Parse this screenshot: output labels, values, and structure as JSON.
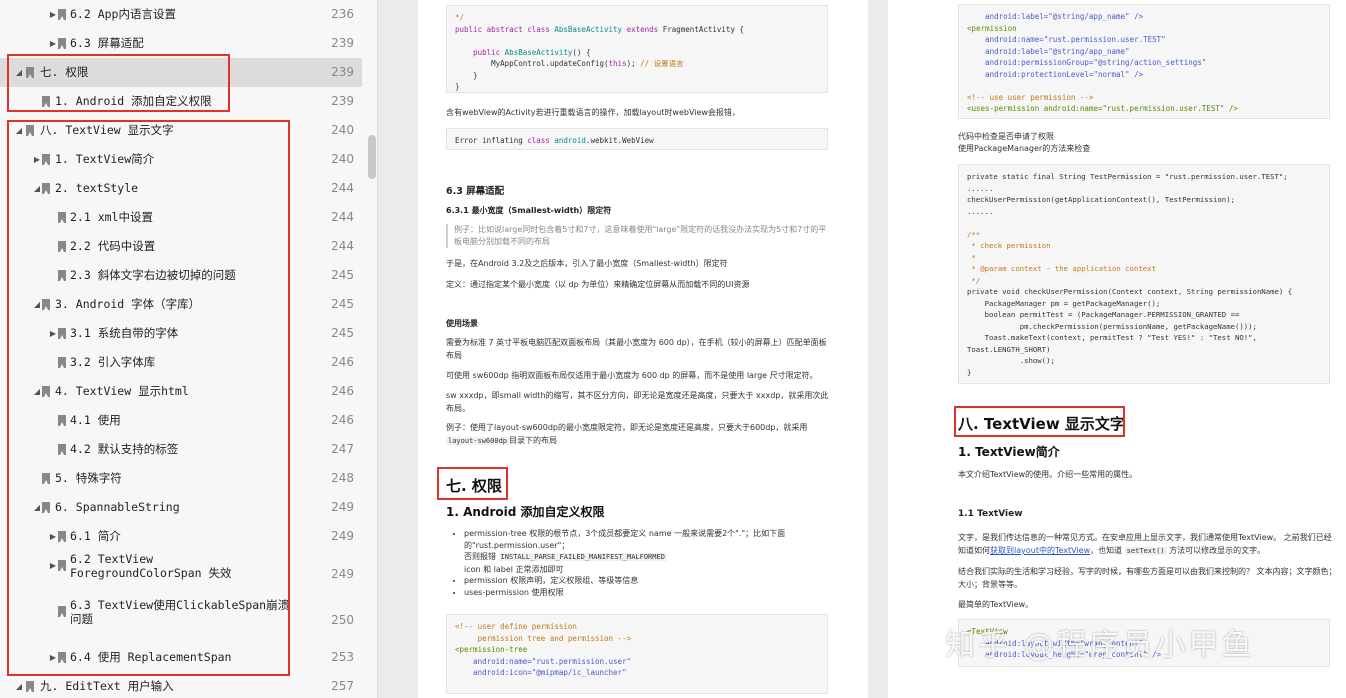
{
  "toc": {
    "items": [
      {
        "label": "6.2 App内语言设置",
        "page": "236",
        "level": 2,
        "arrow": "▶"
      },
      {
        "label": "6.3 屏幕适配",
        "page": "239",
        "level": 2,
        "arrow": "▶"
      },
      {
        "label": "七. 权限",
        "page": "239",
        "level": 0,
        "arrow": "◢",
        "selected": true
      },
      {
        "label": "1. Android 添加自定义权限",
        "page": "239",
        "level": 1,
        "arrow": ""
      },
      {
        "label": "八. TextView 显示文字",
        "page": "240",
        "level": 0,
        "arrow": "◢"
      },
      {
        "label": "1. TextView简介",
        "page": "240",
        "level": 1,
        "arrow": "▶"
      },
      {
        "label": "2. textStyle",
        "page": "244",
        "level": 1,
        "arrow": "◢"
      },
      {
        "label": "2.1 xml中设置",
        "page": "244",
        "level": 2,
        "arrow": ""
      },
      {
        "label": "2.2 代码中设置",
        "page": "244",
        "level": 2,
        "arrow": ""
      },
      {
        "label": "2.3 斜体文字右边被切掉的问题",
        "page": "245",
        "level": 2,
        "arrow": ""
      },
      {
        "label": "3. Android 字体（字库）",
        "page": "245",
        "level": 1,
        "arrow": "◢"
      },
      {
        "label": "3.1 系统自带的字体",
        "page": "245",
        "level": 2,
        "arrow": "▶"
      },
      {
        "label": "3.2 引入字体库",
        "page": "246",
        "level": 2,
        "arrow": ""
      },
      {
        "label": "4. TextView 显示html",
        "page": "246",
        "level": 1,
        "arrow": "◢"
      },
      {
        "label": "4.1 使用",
        "page": "246",
        "level": 2,
        "arrow": ""
      },
      {
        "label": "4.2 默认支持的标签",
        "page": "247",
        "level": 2,
        "arrow": ""
      },
      {
        "label": "5. 特殊字符",
        "page": "248",
        "level": 1,
        "arrow": ""
      },
      {
        "label": "6. SpannableString",
        "page": "249",
        "level": 1,
        "arrow": "◢"
      },
      {
        "label": "6.1 简介",
        "page": "249",
        "level": 2,
        "arrow": "▶"
      },
      {
        "label": "6.2 TextView ForegroundColorSpan 失效",
        "page": "249",
        "level": 2,
        "arrow": "▶",
        "two": true
      },
      {
        "label": "6.3 TextView使用ClickableSpan崩溃问题",
        "page": "250",
        "level": 2,
        "arrow": "",
        "two": true
      },
      {
        "label": "6.4 使用 ReplacementSpan",
        "page": "253",
        "level": 2,
        "arrow": "▶"
      },
      {
        "label": "九. EditText 用户输入",
        "page": "257",
        "level": 0,
        "arrow": "◢"
      }
    ]
  },
  "mid": {
    "code1": [
      "*/",
      "public abstract class AbsBaseActivity extends FragmentActivity {",
      "",
      "    public AbsBaseActivity() {",
      "        MyAppControl.updateConfig(this); // 设置语言",
      "    }",
      "}"
    ],
    "p_webview": "含有webView的Activity若进行重载语言的操作，加载layout时webView会报错，",
    "code2": "Error inflating class android.webkit.WebView",
    "h_63": "6.3 屏幕适配",
    "h_631": "6.3.1 最小宽度（Smallest-width）限定符",
    "quote": "例子：比如说large同时包含着5寸和7寸，这意味着使用\"large\"限定符的话我没办法实现为5寸和7寸的平板电脑分别加载不同的布局",
    "p1": "于是，在Android 3.2及之后版本，引入了最小宽度（Smallest-width）限定符",
    "p2": "定义：通过指定某个最小宽度（以 dp 为单位）来精确定位屏幕从而加载不同的UI资源",
    "h_use": "使用场景",
    "p3": "需要为标准 7 英寸平板电脑匹配双面板布局（其最小宽度为 600 dp），在手机（较小的屏幕上）匹配单面板布局",
    "p4": "可使用 sw600dp 指明双面板布局仅适用于最小宽度为 600 dp 的屏幕，而不是使用 large 尺寸限定符。",
    "p5": "sw xxxdp，即small width的缩写，其不区分方向，即无论是宽度还是高度，只要大于 xxxdp，就采用次此布局。",
    "p6a": "例子：使用了layout-sw600dp的最小宽度限定符，即无论是宽度还是高度，只要大于600dp，就采用",
    "p6code": "layout-sw600dp",
    "p6b": "目录下的布局",
    "h_7": "七. 权限",
    "h_71": "1. Android 添加自定义权限",
    "b1": "permission-tree 权限的根节点，3个成员都要定义 name 一般来说需要2个\".\"；比如下面的\"rust.permission.user\"；",
    "b1b": "否则报错",
    "b1code": "INSTALL_PARSE_FAILED_MANIFEST_MALFORMED",
    "b1c": "icon 和 label 正常添加即可",
    "b2": "permission 权限声明，定义权限组、等级等信息",
    "b3": "uses-permission 使用权限",
    "code3": [
      "<!-- user define permission",
      "     permission tree and permission -->",
      "<permission-tree",
      "    android:name=\"rust.permission.user\"",
      "    android:icon=\"@mipmap/ic_launcher\""
    ]
  },
  "right": {
    "code1": [
      "    android:label=\"@string/app_name\" />",
      "<permission",
      "    android:name=\"rust.permission.user.TEST\"",
      "    android:label=\"@string/app_name\"",
      "    android:permissionGroup=\"@string/action_settings\"",
      "    android:protectionLevel=\"normal\" />",
      "",
      "<!-- use user permission -->",
      "<uses-permission android:name=\"rust.permission.user.TEST\" />"
    ],
    "p_check1": "代码中检查是否申请了权限",
    "p_check2": "使用PackageManager的方法来检查",
    "code2": [
      "private static final String TestPermission = \"rust.permission.user.TEST\";",
      "......",
      "checkUserPermission(getApplicationContext(), TestPermission);",
      "......",
      "",
      "/**",
      " * check permission",
      " *",
      " * @param context - the application context",
      " */",
      "private void checkUserPermission(Context context, String permissionName) {",
      "    PackageManager pm = getPackageManager();",
      "    boolean permitTest = (PackageManager.PERMISSION_GRANTED ==",
      "            pm.checkPermission(permissionName, getPackageName()));",
      "    Toast.makeText(context, permitTest ? \"Test YES!\" : \"Test NO!\",",
      "Toast.LENGTH_SHORT)",
      "            .show();",
      "}"
    ],
    "h_8": "八. TextView 显示文字",
    "h_81": "1. TextView简介",
    "p_intro": "本文介绍TextView的使用。介绍一些常用的属性。",
    "h_811": "1.1 TextView",
    "p_tv1a": "文字，是我们传达信息的一种常见方式。在安卓应用上显示文字，我们通常使用TextView。 之前我们已经知道如何",
    "p_tv1link": "获取到layout中的TextView",
    "p_tv1b": "，也知道",
    "p_tv1code": "setText()",
    "p_tv1c": "方法可以修改显示的文字。",
    "p_tv2": "结合我们实际的生活和学习经验，写字的时候，有哪些方面是可以由我们来控制的？ 文本内容；文字颜色；大小；背景等等。",
    "p_tv3": "最简单的TextView。",
    "code3": [
      "<TextView",
      "    android:layout_width=\"wrap_content\"",
      "    android:layout_height=\"wrap_content\" />"
    ]
  },
  "watermark": "知乎 @程序员小甲鱼"
}
